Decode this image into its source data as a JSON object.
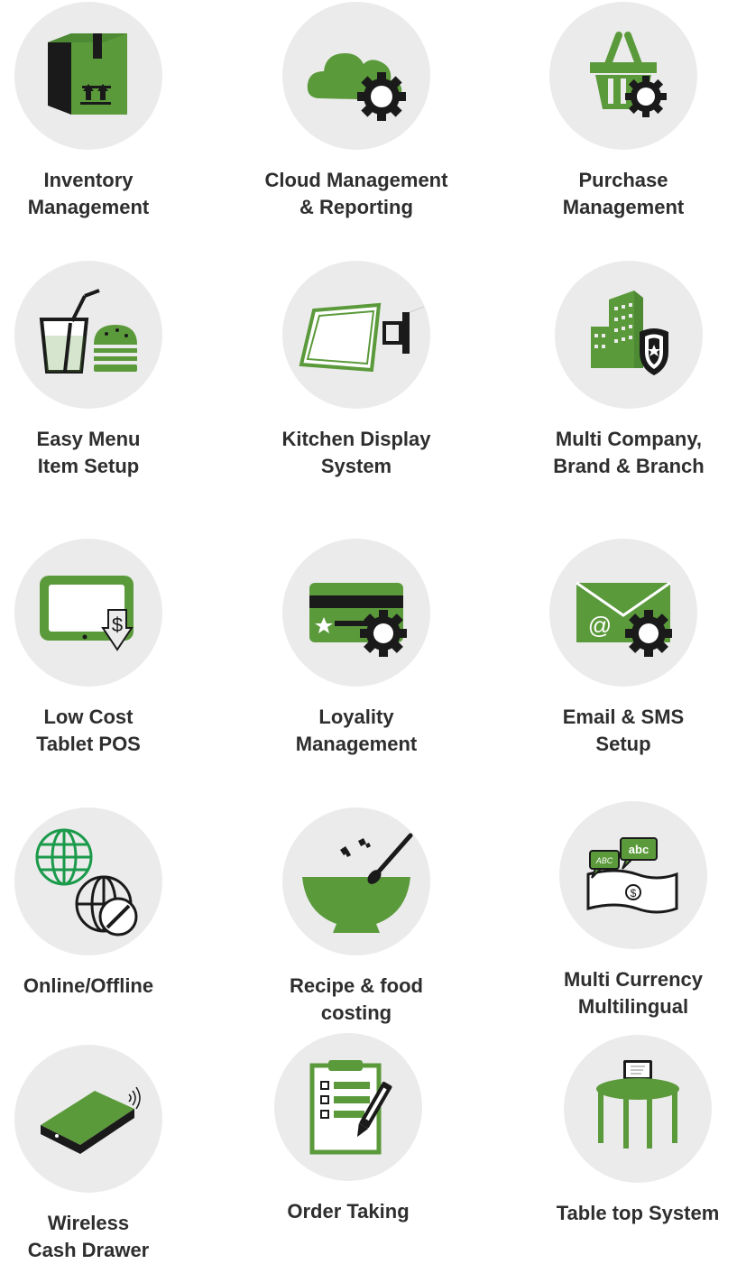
{
  "colors": {
    "accent": "#5b9a3b",
    "dark": "#1a1a1a",
    "circle_bg": "#ebebeb",
    "text": "#2e2e2e",
    "globe_green": "#1a9a4a"
  },
  "features": [
    {
      "label": "Inventory\nManagement",
      "icon": "box-icon"
    },
    {
      "label": "Cloud Management\n& Reporting",
      "icon": "cloud-gear-icon"
    },
    {
      "label": "Purchase\nManagement",
      "icon": "basket-gear-icon"
    },
    {
      "label": "Easy Menu\nItem Setup",
      "icon": "drink-burger-icon"
    },
    {
      "label": "Kitchen Display\nSystem",
      "icon": "wall-display-icon"
    },
    {
      "label": "Multi Company,\nBrand & Branch",
      "icon": "building-shield-icon"
    },
    {
      "label": "Low Cost\nTablet POS",
      "icon": "tablet-dollar-icon"
    },
    {
      "label": "Loyality\nManagement",
      "icon": "card-gear-icon"
    },
    {
      "label": "Email & SMS\nSetup",
      "icon": "envelope-gear-icon"
    },
    {
      "label": "Online/Offline",
      "icon": "globe-offline-icon"
    },
    {
      "label": "Recipe & food\ncosting",
      "icon": "mortar-pestle-icon"
    },
    {
      "label": "Multi Currency\nMultilingual",
      "icon": "currency-speech-icon"
    },
    {
      "label": "Wireless\nCash Drawer",
      "icon": "cash-drawer-icon"
    },
    {
      "label": "Order Taking",
      "icon": "clipboard-pen-icon"
    },
    {
      "label": "Table top System",
      "icon": "table-tablet-icon"
    }
  ]
}
